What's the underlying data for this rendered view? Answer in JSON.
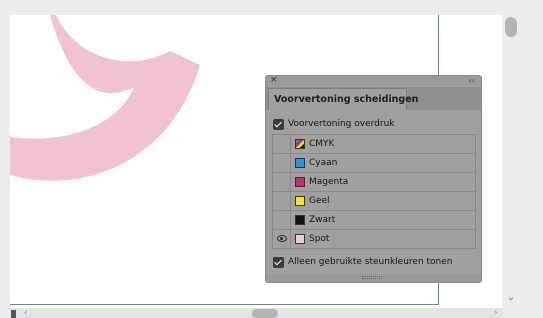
{
  "panel": {
    "close_glyph": "×",
    "collapse_glyph": "‹‹",
    "tab_label": "Voorvertoning scheidingen",
    "overprint_label": "Voorvertoning overdruk",
    "overprint_checked": true,
    "unused_inks_label": "Alleen gebruikte steunkleuren tonen",
    "unused_inks_checked": true,
    "separations": [
      {
        "label": "CMYK",
        "icon": "cmyk-swatch-icon",
        "color": "#000000",
        "visible": false
      },
      {
        "label": "Cyaan",
        "icon": "swatch-icon",
        "color": "#1f9ad6",
        "visible": false
      },
      {
        "label": "Magenta",
        "icon": "swatch-icon",
        "color": "#d0267a",
        "visible": false
      },
      {
        "label": "Geel",
        "icon": "swatch-icon",
        "color": "#f4e81a",
        "visible": false
      },
      {
        "label": "Zwart",
        "icon": "swatch-icon",
        "color": "#111111",
        "visible": false
      },
      {
        "label": "Spot",
        "icon": "swatch-icon",
        "color": "#f3c6d8",
        "visible": true
      }
    ]
  },
  "scrollbars": {
    "down_arrow": "⌄",
    "left_arrow": "‹",
    "right_arrow": "›"
  },
  "colors": {
    "spot_shape": "#f0c2d4",
    "guide": "#5a7fd6",
    "panel_bg": "#a0a0a0"
  }
}
